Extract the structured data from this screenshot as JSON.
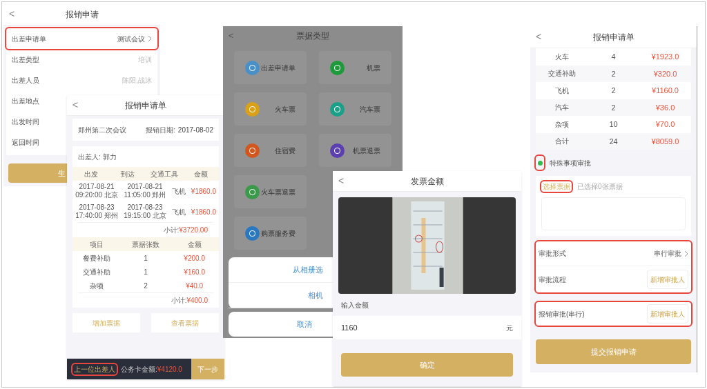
{
  "trip_form": {
    "title": "报销申请",
    "back": "<",
    "rows": [
      {
        "label": "出差申请单",
        "value": "测试会议",
        "chevron": true,
        "highlighted": true
      },
      {
        "label": "出差类型",
        "value": "培训",
        "chevron": false,
        "highlighted": false
      },
      {
        "label": "出差人员",
        "value": "陈阳,战冰",
        "chevron": false,
        "highlighted": false
      },
      {
        "label": "出差地点",
        "highlighted": false
      },
      {
        "label": "出发时间",
        "highlighted": false
      },
      {
        "label": "返回时间",
        "highlighted": false
      }
    ],
    "button": "生"
  },
  "reimbursement_form": {
    "title": "报销申请单",
    "back": "<",
    "meeting": "郑州第二次会议",
    "date_label": "报销日期:",
    "date": "2017-08-02",
    "traveler": "出差人: 郭力",
    "trip_columns": [
      "出发",
      "到达",
      "交通工具",
      "金额"
    ],
    "trips": [
      {
        "depart_time": "2017-08-21",
        "depart_clock": "09:20:00",
        "depart_city": "北京",
        "arrive_time": "2017-08-21",
        "arrive_clock": "11:05:00",
        "arrive_city": "郑州",
        "transport": "飞机",
        "amount": "¥1860.0"
      },
      {
        "depart_time": "2017-08-23",
        "depart_clock": "17:40:00",
        "depart_city": "郑州",
        "arrive_time": "2017-08-23",
        "arrive_clock": "19:15:00",
        "arrive_city": "北京",
        "transport": "飞机",
        "amount": "¥1860.0"
      }
    ],
    "trip_subtotal_label": "小计:",
    "trip_subtotal": "¥3720.00",
    "item_columns": [
      "项目",
      "票据张数",
      "金额"
    ],
    "items": [
      {
        "name": "餐费补助",
        "count": "1",
        "amount": "¥200.0"
      },
      {
        "name": "交通补助",
        "count": "1",
        "amount": "¥160.0"
      },
      {
        "name": "杂项",
        "count": "2",
        "amount": "¥40.0"
      }
    ],
    "item_subtotal_label": "小计:",
    "item_subtotal": "¥400.0",
    "actions": [
      "增加票据",
      "查看票据"
    ],
    "footer": {
      "prev": "上一位出差人",
      "prev_highlighted": true,
      "card_label": "公务卡金额:",
      "card_amount": "¥4120.0",
      "next": "下一步"
    }
  },
  "bill_types": {
    "title": "票据类型",
    "back": "<",
    "tiles": [
      [
        {
          "label": "出差申请单",
          "color": "#4a90c8"
        },
        {
          "label": "机票",
          "color": "#1f9a3a"
        }
      ],
      [
        {
          "label": "火车票",
          "color": "#d9a019"
        },
        {
          "label": "汽车票",
          "color": "#1aa088"
        }
      ],
      [
        {
          "label": "住宿费",
          "color": "#d2571e"
        },
        {
          "label": "机票退票",
          "color": "#5b3fae"
        }
      ],
      [
        {
          "label": "火车票退票",
          "color": "#3a9a4a"
        }
      ],
      [
        {
          "label": "购票服务费",
          "color": "#2a78c0"
        }
      ]
    ],
    "sheet": {
      "options": [
        "从相册选",
        "相机"
      ],
      "cancel": "取消"
    }
  },
  "invoice_amount": {
    "title": "发票金额",
    "back": "<",
    "label": "输入金额",
    "value": "1160",
    "unit": "元",
    "button": "确定"
  },
  "reimbursement_summary": {
    "title": "报销申请单",
    "back": "<",
    "rows": [
      {
        "name": "火车",
        "count": "4",
        "amount": "¥1923.0"
      },
      {
        "name": "交通补助",
        "count": "2",
        "amount": "¥320.0"
      },
      {
        "name": "飞机",
        "count": "2",
        "amount": "¥1160.0"
      },
      {
        "name": "汽车",
        "count": "2",
        "amount": "¥36.0"
      },
      {
        "name": "杂项",
        "count": "10",
        "amount": "¥70.0"
      },
      {
        "name": "合计",
        "count": "24",
        "amount": "¥8059.0"
      }
    ],
    "special": {
      "label": "特殊事项审批",
      "checked": true,
      "highlighted": true
    },
    "select": {
      "label": "选择票据",
      "highlighted": true,
      "note": "已选择0张票据"
    },
    "approval_form": {
      "label": "审批形式",
      "value": "串行审批",
      "chevron": true
    },
    "approval_flow": {
      "label": "审批流程",
      "button": "新增审批人"
    },
    "approval_group_highlighted": true,
    "reimburse_approval": {
      "label": "报销审批(串行)",
      "button": "新增审批人",
      "highlighted": true
    },
    "submit": "提交报销申请"
  }
}
